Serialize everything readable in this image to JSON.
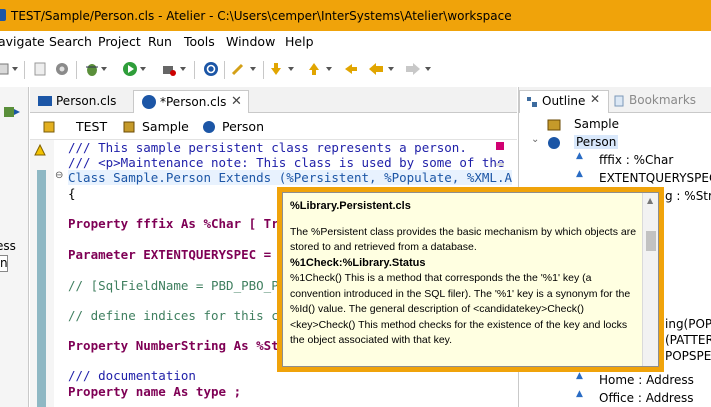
{
  "window": {
    "title": "TEST/Sample/Person.cls - Atelier - C:\\Users\\cemper\\InterSystems\\Atelier\\workspace"
  },
  "menu": [
    "avigate",
    "Search",
    "Project",
    "Run",
    "Tools",
    "Window",
    "Help"
  ],
  "left_panel": {
    "label": "ess",
    "input_value": "n"
  },
  "editor": {
    "tabs": [
      {
        "label": "Person.cls",
        "active": false
      },
      {
        "label": "*Person.cls",
        "active": true
      }
    ],
    "breadcrumb": [
      "TEST",
      "Sample",
      "Person"
    ],
    "code_lines": [
      "/// This sample persistent class represents a person.",
      "/// <p>Maintenance note: This class is used by some of the",
      "Class Sample.Person Extends (%Persistent, %Populate, %XML.A",
      "{",
      "",
      "Property fffix As %Char [ Tran",
      "",
      "Parameter EXTENTQUERYSPEC = \"N",
      "",
      "// [SqlFieldName = PBD_PBO_Par",
      "",
      "// define indices for this cla",
      "",
      "Property NumberString As %Stri",
      "",
      "/// documentation",
      "Property name As type ;"
    ]
  },
  "outline": {
    "tabs": [
      "Outline",
      "Bookmarks"
    ],
    "items": [
      {
        "label": "Sample"
      },
      {
        "label": "Person"
      },
      {
        "label": "fffix : %Char"
      },
      {
        "label": "EXTENTQUERYSPEC"
      },
      {
        "label": "g : %Stri"
      },
      {
        "label": "ing(POPS"
      },
      {
        "label": "(PATTER"
      },
      {
        "label": "POPSPE"
      },
      {
        "label": "Home : Address"
      },
      {
        "label": "Office : Address"
      }
    ]
  },
  "popup": {
    "title": "%Library.Persistent.cls",
    "desc": "The %Persistent class provides the basic mechanism by which objects are stored to and retrieved from a database.",
    "method_title": "%1Check:%Library.Status",
    "method_desc": "%1Check() This is a method that corresponds the the '%1' key (a convention introduced in the SQL filer). The '%1' key is a synonym for the %Id() value. The general description of <candidatekey>Check() <key>Check() This method checks for the existence of the key and locks the object associated with that key."
  }
}
